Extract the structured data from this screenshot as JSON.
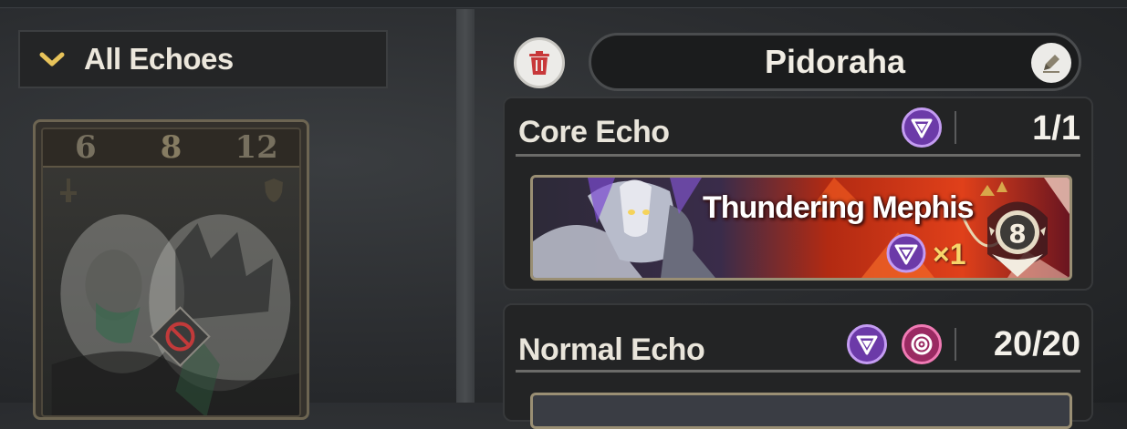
{
  "filter": {
    "label": "All Echoes",
    "icon": "chevron-down-icon"
  },
  "card": {
    "stats": [
      "6",
      "8",
      "12"
    ],
    "status_icon": "forbidden-icon"
  },
  "preset": {
    "name": "Pidoraha",
    "delete_icon": "trash-icon",
    "edit_icon": "pencil-icon"
  },
  "core_echo": {
    "title": "Core Echo",
    "count": "1/1",
    "sonata_icon": "void-thunder-sonata-icon",
    "echo": {
      "name": "Thundering Mephis",
      "multiplier": "×1",
      "cost": "8"
    }
  },
  "normal_echo": {
    "title": "Normal Echo",
    "count": "20/20",
    "sonata_icons": [
      "void-thunder-sonata-icon",
      "moonlit-clouds-sonata-icon"
    ]
  },
  "colors": {
    "accent_gold": "#e7c35a",
    "purple": "#6c3aa8",
    "pink": "#9a2a62",
    "trash_red": "#c8383a",
    "banner_red": "#e0401a"
  }
}
